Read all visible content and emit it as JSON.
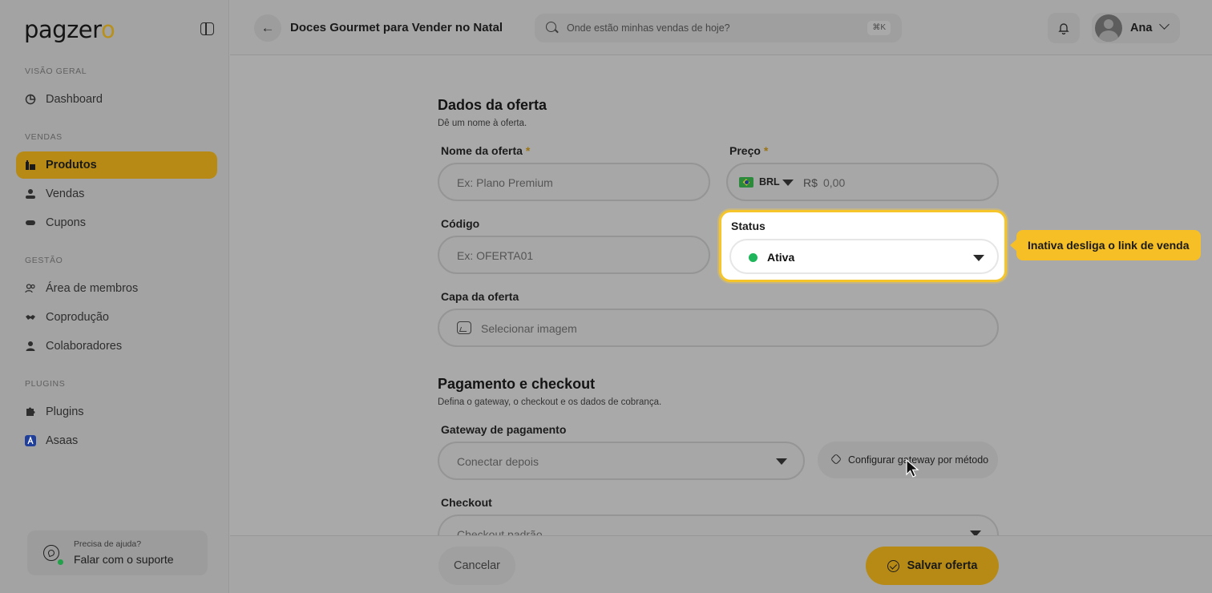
{
  "brand": {
    "logo_text": "pagzer",
    "logo_accent": "o",
    "accent_color": "#b68a14"
  },
  "sidebar": {
    "sections": [
      {
        "label": "Visão geral",
        "items": [
          {
            "label": "Dashboard",
            "icon": "dashboard-icon"
          }
        ]
      },
      {
        "label": "Vendas",
        "items": [
          {
            "label": "Produtos",
            "icon": "products-icon",
            "active": true
          },
          {
            "label": "Vendas",
            "icon": "sales-icon"
          },
          {
            "label": "Cupons",
            "icon": "coupon-icon"
          }
        ]
      },
      {
        "label": "Gestão",
        "items": [
          {
            "label": "Área de membros",
            "icon": "members-icon"
          },
          {
            "label": "Coprodução",
            "icon": "handshake-icon"
          },
          {
            "label": "Colaboradores",
            "icon": "user-icon"
          }
        ]
      },
      {
        "label": "Plugins",
        "items": [
          {
            "label": "Plugins",
            "icon": "puzzle-icon"
          },
          {
            "label": "Asaas",
            "icon": "asaas-icon"
          }
        ]
      }
    ],
    "help": {
      "title": "Precisa de ajuda?",
      "action": "Falar com o suporte"
    }
  },
  "header": {
    "title": "Doces Gourmet para Vender no Natal",
    "search_placeholder": "Onde estão minhas vendas de hoje?",
    "search_shortcut": "⌘K",
    "user_name": "Ana"
  },
  "form": {
    "offer_section": {
      "title": "Dados da oferta",
      "subtitle": "Dê um nome à oferta."
    },
    "name": {
      "label": "Nome da oferta",
      "required": "*",
      "placeholder": "Ex: Plano Premium"
    },
    "price": {
      "label": "Preço",
      "required": "*",
      "currency": "BRL",
      "symbol": "R$",
      "placeholder": "0,00"
    },
    "code": {
      "label": "Código",
      "placeholder": "Ex: OFERTA01"
    },
    "status": {
      "label": "Status",
      "value": "Ativa",
      "status_color": "#1fb55a",
      "tooltip": "Inativa desliga o link de venda"
    },
    "cover": {
      "label": "Capa da oferta",
      "placeholder": "Selecionar imagem"
    },
    "payment_section": {
      "title": "Pagamento e checkout",
      "subtitle": "Defina o gateway, o checkout e os dados de cobrança."
    },
    "gateway": {
      "label": "Gateway de pagamento",
      "value": "Conectar depois",
      "config_button": "Configurar gateway por método"
    },
    "checkout": {
      "label": "Checkout",
      "value": "Checkout padrão"
    }
  },
  "footer": {
    "cancel": "Cancelar",
    "save": "Salvar oferta"
  }
}
